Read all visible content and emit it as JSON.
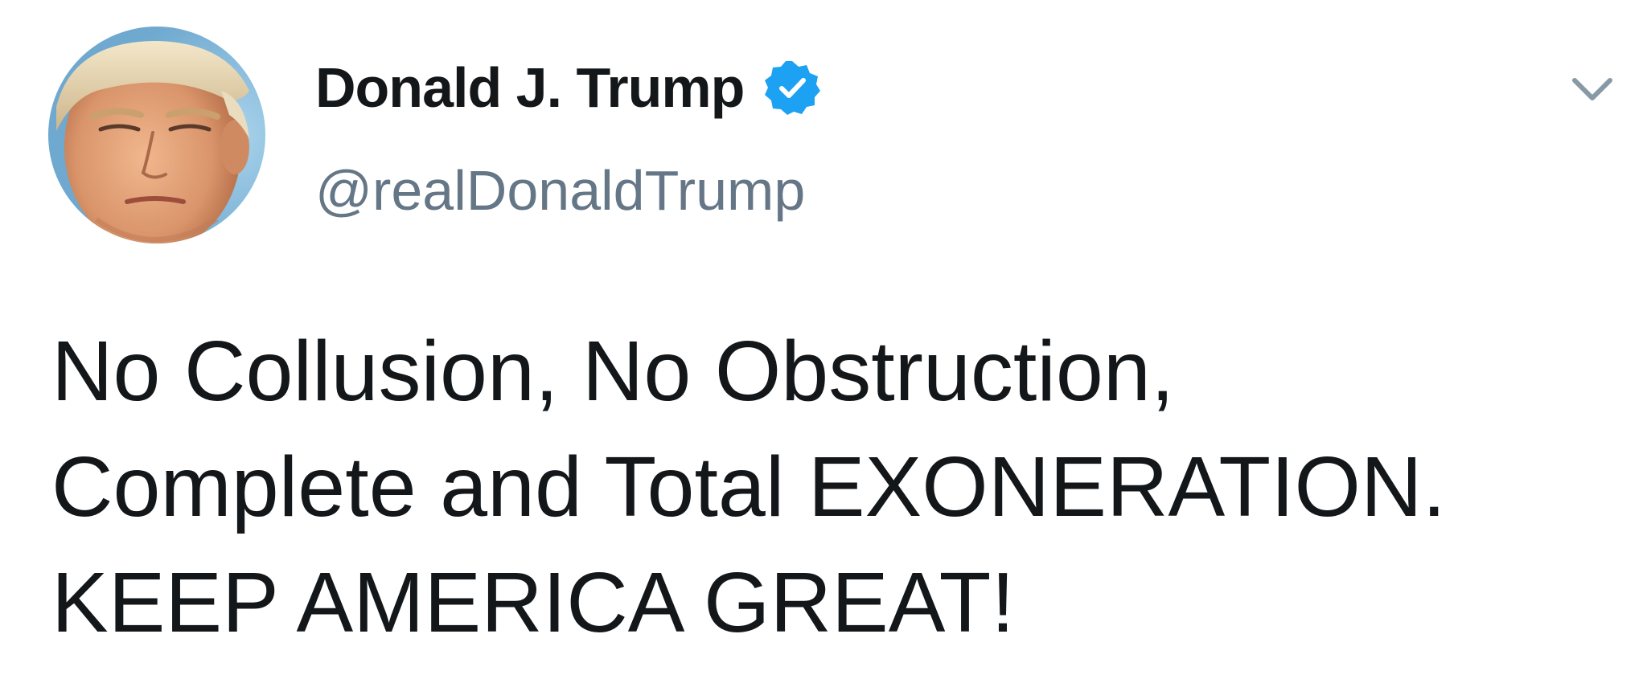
{
  "tweet": {
    "author": {
      "display_name": "Donald J. Trump",
      "handle": "@realDonaldTrump",
      "verified": true,
      "verified_icon": "verified-badge-icon",
      "avatar_icon": "avatar-photo"
    },
    "menu_icon": "chevron-down-icon",
    "text_lines": [
      "No Collusion, No Obstruction,",
      "Complete and Total EXONERATION.",
      "KEEP AMERICA GREAT!"
    ]
  },
  "colors": {
    "text": "#14171a",
    "handle": "#657786",
    "verified": "#1da1f2",
    "caret": "#8899a6",
    "background": "#ffffff"
  }
}
